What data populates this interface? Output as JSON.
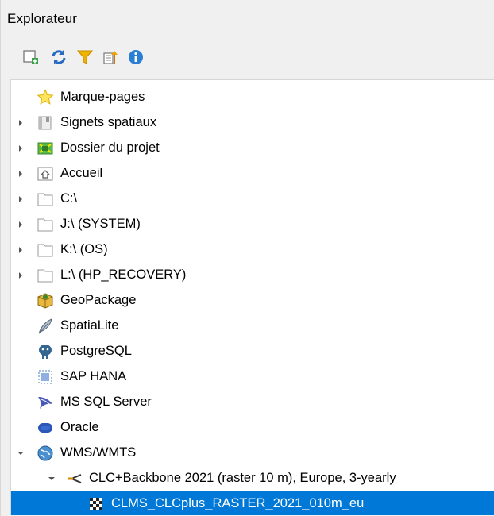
{
  "panel": {
    "title": "Explorateur"
  },
  "toolbar": {
    "buttons": [
      {
        "name": "add-layer-icon"
      },
      {
        "name": "refresh-icon"
      },
      {
        "name": "filter-icon"
      },
      {
        "name": "collapse-all-icon"
      },
      {
        "name": "properties-info-icon"
      }
    ]
  },
  "tree": {
    "items": [
      {
        "label": "Marque-pages",
        "icon": "star-icon",
        "expander": "none"
      },
      {
        "label": "Signets spatiaux",
        "icon": "spatial-bookmarks-icon",
        "expander": "collapsed"
      },
      {
        "label": "Dossier du projet",
        "icon": "project-folder-icon",
        "expander": "collapsed"
      },
      {
        "label": "Accueil",
        "icon": "home-folder-icon",
        "expander": "collapsed"
      },
      {
        "label": "C:\\",
        "icon": "folder-icon",
        "expander": "collapsed"
      },
      {
        "label": "J:\\ (SYSTEM)",
        "icon": "folder-icon",
        "expander": "collapsed"
      },
      {
        "label": "K:\\ (OS)",
        "icon": "folder-icon",
        "expander": "collapsed"
      },
      {
        "label": "L:\\ (HP_RECOVERY)",
        "icon": "folder-icon",
        "expander": "collapsed"
      },
      {
        "label": "GeoPackage",
        "icon": "geopackage-icon",
        "expander": "none"
      },
      {
        "label": "SpatiaLite",
        "icon": "spatialite-feather-icon",
        "expander": "none"
      },
      {
        "label": "PostgreSQL",
        "icon": "postgresql-elephant-icon",
        "expander": "none"
      },
      {
        "label": "SAP HANA",
        "icon": "sap-hana-icon",
        "expander": "none"
      },
      {
        "label": "MS SQL Server",
        "icon": "mssql-icon",
        "expander": "none"
      },
      {
        "label": "Oracle",
        "icon": "oracle-icon",
        "expander": "none"
      },
      {
        "label": "WMS/WMTS",
        "icon": "wms-globe-icon",
        "expander": "expanded"
      },
      {
        "label": "CLC+Backbone 2021 (raster 10 m), Europe, 3-yearly",
        "icon": "wms-connection-icon",
        "expander": "expanded"
      },
      {
        "label": "CLMS_CLCplus_RASTER_2021_010m_eu",
        "icon": "raster-layer-icon",
        "expander": "none",
        "selected": true
      }
    ]
  },
  "colors": {
    "selection": "#0078d7",
    "accent": "#2a7fd4"
  }
}
